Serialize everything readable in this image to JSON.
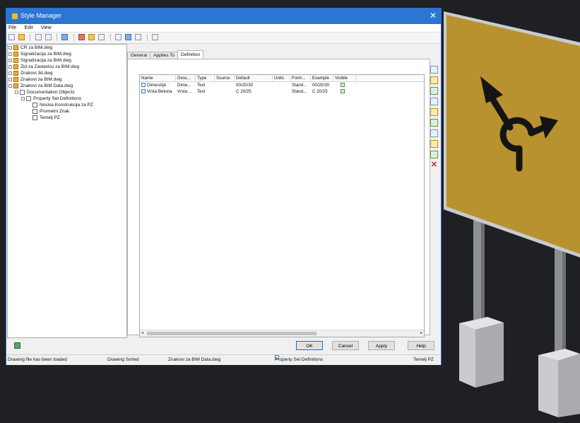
{
  "window": {
    "title": "Style Manager",
    "close_glyph": "✕"
  },
  "menu": [
    "File",
    "Edit",
    "View"
  ],
  "tree": {
    "items": [
      {
        "label": "CR za BIM.dwg",
        "level": 0,
        "icon": "dwg-file-icon"
      },
      {
        "label": "Signalizacija za BIM.dwg",
        "level": 0,
        "icon": "dwg-file-icon"
      },
      {
        "label": "Signalizacija za BIM.dwg",
        "level": 0,
        "icon": "dwg-file-icon"
      },
      {
        "label": "Zid za Zastavicu za BIM.dwg",
        "level": 0,
        "icon": "dwg-file-icon"
      },
      {
        "label": "Znakovi 3d.dwg",
        "level": 0,
        "icon": "dwg-file-icon"
      },
      {
        "label": "Znakovi za BIM.dwg",
        "level": 0,
        "icon": "dwg-file-icon"
      },
      {
        "label": "Znakovi za BIM Data.dwg",
        "level": 0,
        "icon": "dwg-file-icon"
      },
      {
        "label": "Documentation Objects",
        "level": 1,
        "icon": "folder-icon"
      },
      {
        "label": "Property Set Definitions",
        "level": 2,
        "icon": "folder-icon"
      },
      {
        "label": "Nosiva Konstrukcija za PZ",
        "level": 3,
        "icon": "property-set-icon"
      },
      {
        "label": "Prometni Znak",
        "level": 3,
        "icon": "property-set-icon"
      },
      {
        "label": "Temelj PZ",
        "level": 3,
        "icon": "property-set-icon"
      }
    ]
  },
  "tabs": [
    {
      "label": "General",
      "active": false
    },
    {
      "label": "Applies To",
      "active": false
    },
    {
      "label": "Definition",
      "active": true
    }
  ],
  "grid": {
    "columns": [
      "Name",
      "Desc...",
      "Type",
      "Source",
      "Default",
      "Units",
      "Form...",
      "Example",
      "Visible"
    ],
    "rows": [
      {
        "name": "Dimenzije",
        "desc": "Dime...",
        "type": "Text",
        "source": "",
        "default": "00/20/30",
        "units": "",
        "format": "Stand...",
        "example": "00/20/30",
        "visible": true
      },
      {
        "name": "Vrsta Betona",
        "desc": "Vrsta ...",
        "type": "Text",
        "source": "",
        "default": "C 20/25",
        "units": "",
        "format": "Stand...",
        "example": "C 20/25",
        "visible": true
      }
    ]
  },
  "side_buttons": [
    "add-property-icon",
    "add-automatic-property-icon",
    "add-formula-icon",
    "add-location-icon",
    "add-classification-icon",
    "add-material-icon",
    "add-graphic-icon",
    "add-project-icon",
    "edit-property-icon",
    "delete-icon"
  ],
  "buttons": {
    "ok": "OK",
    "cancel": "Cancel",
    "apply": "Apply",
    "help": "Help"
  },
  "status": {
    "message": "Drawing file has been loaded",
    "sort": "Drawing Sorted",
    "drawing": "Znakovi za BIM Data.dwg",
    "category": "Property Set Definitions",
    "item": "Temelj PZ"
  },
  "colors": {
    "titlebar": "#2a76d2",
    "sign_panel": "#b8922f",
    "background": "#1e2024",
    "delete": "#e21b1b"
  }
}
